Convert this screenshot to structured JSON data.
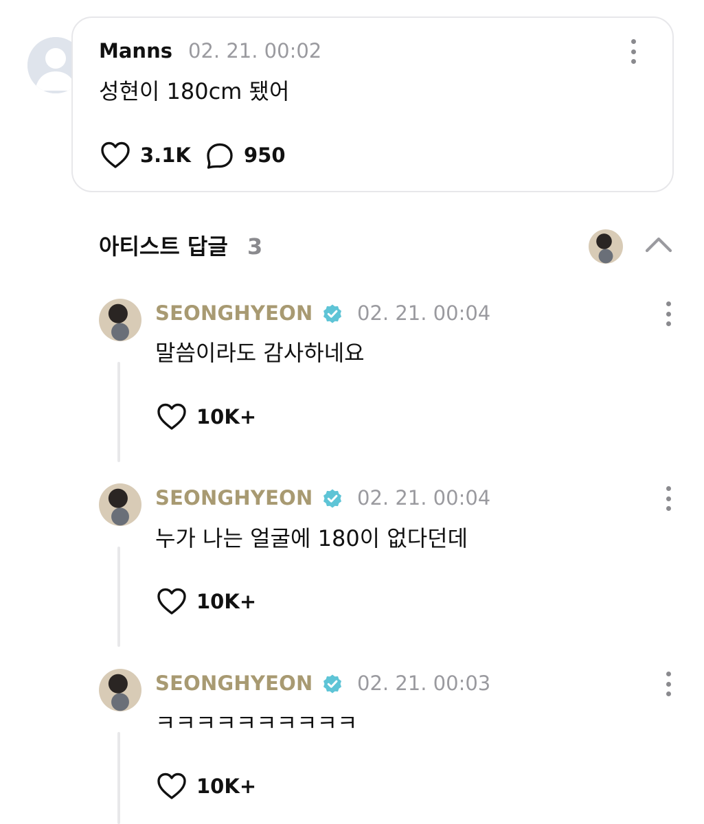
{
  "post": {
    "author": "Manns",
    "time": "02. 21. 00:02",
    "text": "성현이 180cm 됐어",
    "like_count": "3.1K",
    "comment_count": "950",
    "avatar_icon": "default-user-avatar"
  },
  "artist_replies": {
    "title": "아티스트 답글",
    "count": "3",
    "items": [
      {
        "author": "SEONGHYEON",
        "time": "02. 21. 00:04",
        "text": "말씀이라도 감사하네요",
        "likes": "10K+"
      },
      {
        "author": "SEONGHYEON",
        "time": "02. 21. 00:04",
        "text": "누가 나는 얼굴에 180이 없다던데",
        "likes": "10K+"
      },
      {
        "author": "SEONGHYEON",
        "time": "02. 21. 00:03",
        "text": "ㅋㅋㅋㅋㅋㅋㅋㅋㅋㅋ",
        "likes": "10K+"
      }
    ]
  },
  "colors": {
    "artist_name": "#a89a72",
    "verified_badge": "#5ec4d6",
    "muted": "#9a9a9f",
    "card_border": "#e7e7ea"
  },
  "icons": {
    "like": "heart-outline-icon",
    "comment": "speech-bubble-icon",
    "more": "vertical-dots-icon",
    "collapse": "chevron-up-icon",
    "verified": "verified-badge-icon"
  }
}
